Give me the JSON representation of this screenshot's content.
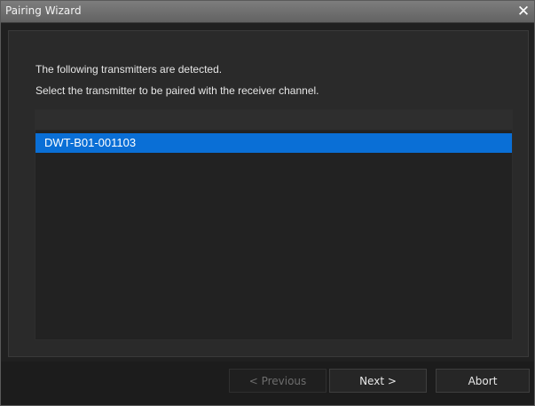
{
  "window": {
    "title": "Pairing Wizard",
    "close_symbol": "✕"
  },
  "instructions": {
    "line1": "The following transmitters are detected.",
    "line2": "Select the transmitter to be paired with the receiver channel."
  },
  "transmitter_list": {
    "items": [
      {
        "label": "DWT-B01-001103",
        "selected": true
      }
    ]
  },
  "buttons": {
    "previous": "< Previous",
    "next": "Next >",
    "abort": "Abort"
  },
  "colors": {
    "selection": "#0a6fd6",
    "title_bar": "#6e6e6e",
    "background": "#2a2a2a"
  }
}
